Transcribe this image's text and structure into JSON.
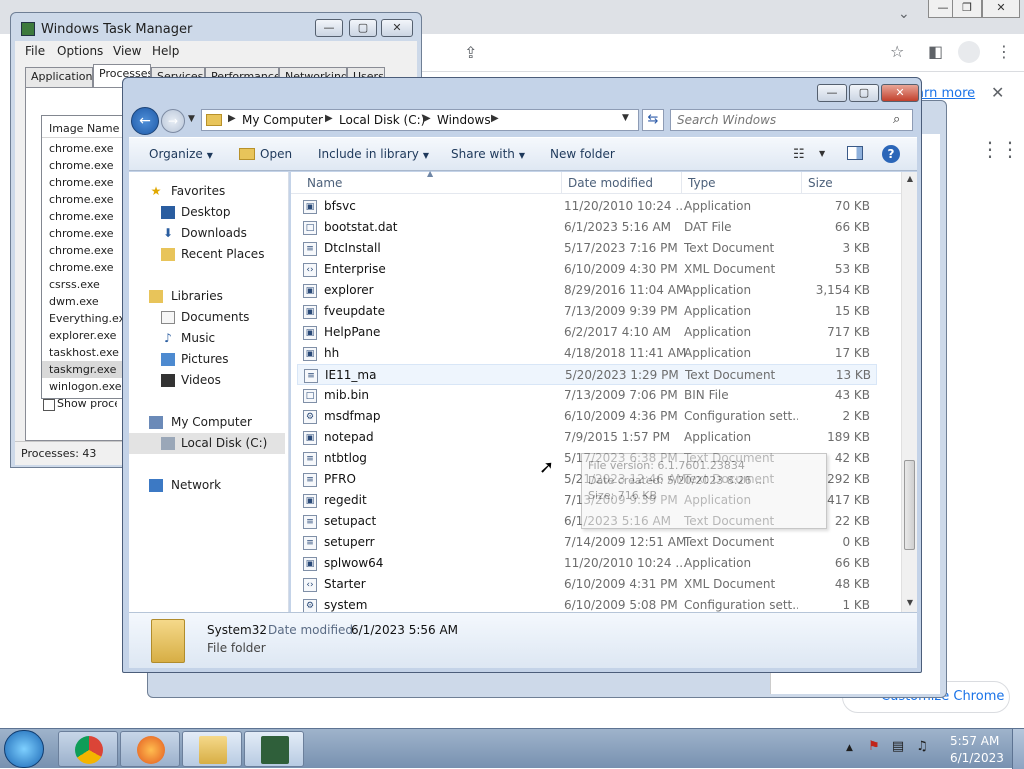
{
  "chrome": {
    "minimize": "—",
    "restore": "❐",
    "close": "✕",
    "tab_dropdown": "⌄",
    "share_icon": "share-icon",
    "star_icon": "star-icon",
    "sidepanel_icon": "sidepanel-icon",
    "profile_icon": "profile-icon",
    "menu_icon": "menu-icon",
    "learn_more": "arn more",
    "close_info": "✕",
    "customize": "Customize Chrome"
  },
  "taskmgr": {
    "title": "Windows Task Manager",
    "menus": [
      "File",
      "Options",
      "View",
      "Help"
    ],
    "tabs": [
      "Applications",
      "Processes",
      "Services",
      "Performance",
      "Networking",
      "Users"
    ],
    "column": "Image Name",
    "processes": [
      "chrome.exe",
      "chrome.exe",
      "chrome.exe",
      "chrome.exe",
      "chrome.exe",
      "chrome.exe",
      "chrome.exe",
      "chrome.exe",
      "csrss.exe",
      "dwm.exe",
      "Everything.exe",
      "explorer.exe",
      "taskhost.exe",
      "taskmgr.exe",
      "winlogon.exe"
    ],
    "selected_index": 13,
    "show_all": "Show processes from all users",
    "status": "Processes: 43"
  },
  "explorer": {
    "breadcrumbs": [
      "My Computer",
      "Local Disk (C:)",
      "Windows"
    ],
    "search_placeholder": "Search Windows",
    "commands": {
      "organize": "Organize",
      "open": "Open",
      "include": "Include in library",
      "share": "Share with",
      "new_folder": "New folder"
    },
    "nav": {
      "favorites": "Favorites",
      "desktop": "Desktop",
      "downloads": "Downloads",
      "recent": "Recent Places",
      "libraries": "Libraries",
      "documents": "Documents",
      "music": "Music",
      "pictures": "Pictures",
      "videos": "Videos",
      "computer": "My Computer",
      "local_disk": "Local Disk (C:)",
      "network": "Network"
    },
    "columns": {
      "name": "Name",
      "date": "Date modified",
      "type": "Type",
      "size": "Size"
    },
    "files": [
      {
        "name": "bfsvc",
        "date": "11/20/2010 10:24 ...",
        "type": "Application",
        "size": "70 KB"
      },
      {
        "name": "bootstat.dat",
        "date": "6/1/2023 5:16 AM",
        "type": "DAT File",
        "size": "66 KB"
      },
      {
        "name": "DtcInstall",
        "date": "5/17/2023 7:16 PM",
        "type": "Text Document",
        "size": "3 KB"
      },
      {
        "name": "Enterprise",
        "date": "6/10/2009 4:30 PM",
        "type": "XML Document",
        "size": "53 KB"
      },
      {
        "name": "explorer",
        "date": "8/29/2016 11:04 AM",
        "type": "Application",
        "size": "3,154 KB"
      },
      {
        "name": "fveupdate",
        "date": "7/13/2009 9:39 PM",
        "type": "Application",
        "size": "15 KB"
      },
      {
        "name": "HelpPane",
        "date": "6/2/2017 4:10 AM",
        "type": "Application",
        "size": "717 KB"
      },
      {
        "name": "hh",
        "date": "4/18/2018 11:41 AM",
        "type": "Application",
        "size": "17 KB"
      },
      {
        "name": "IE11_ma",
        "date": "5/20/2023 1:29 PM",
        "type": "Text Document",
        "size": "13 KB"
      },
      {
        "name": "mib.bin",
        "date": "7/13/2009 7:06 PM",
        "type": "BIN File",
        "size": "43 KB"
      },
      {
        "name": "msdfmap",
        "date": "6/10/2009 4:36 PM",
        "type": "Configuration sett...",
        "size": "2 KB"
      },
      {
        "name": "notepad",
        "date": "7/9/2015 1:57 PM",
        "type": "Application",
        "size": "189 KB"
      },
      {
        "name": "ntbtlog",
        "date": "5/17/2023 6:38 PM",
        "type": "Text Document",
        "size": "42 KB"
      },
      {
        "name": "PFRO",
        "date": "5/21/2023 12:46 AM",
        "type": "Text Document",
        "size": "292 KB"
      },
      {
        "name": "regedit",
        "date": "7/13/2009 9:39 PM",
        "type": "Application",
        "size": "417 KB"
      },
      {
        "name": "setupact",
        "date": "6/1/2023 5:16 AM",
        "type": "Text Document",
        "size": "22 KB"
      },
      {
        "name": "setuperr",
        "date": "7/14/2009 12:51 AM",
        "type": "Text Document",
        "size": "0 KB"
      },
      {
        "name": "splwow64",
        "date": "11/20/2010 10:24 ...",
        "type": "Application",
        "size": "66 KB"
      },
      {
        "name": "Starter",
        "date": "6/10/2009 4:31 PM",
        "type": "XML Document",
        "size": "48 KB"
      },
      {
        "name": "system",
        "date": "6/10/2009 5:08 PM",
        "type": "Configuration sett...",
        "size": "1 KB"
      }
    ],
    "hover_index": 8,
    "tooltip": {
      "version": "File version: 6.1.7601.23834",
      "created": "Date created: 5/20/2023 8:26 ...",
      "size": "Size: 716 KB"
    },
    "details": {
      "name": "System32",
      "modified_label": "Date modified:",
      "modified_value": "6/1/2023 5:56 AM",
      "type": "File folder"
    }
  },
  "taskbar": {
    "time": "5:57 AM",
    "date": "6/1/2023",
    "tray_arrow": "▲"
  },
  "colors": {
    "accent_link": "#1a73e8",
    "explorer_frame": "#c4d3e8",
    "taskbar": "#8ea4c2"
  }
}
